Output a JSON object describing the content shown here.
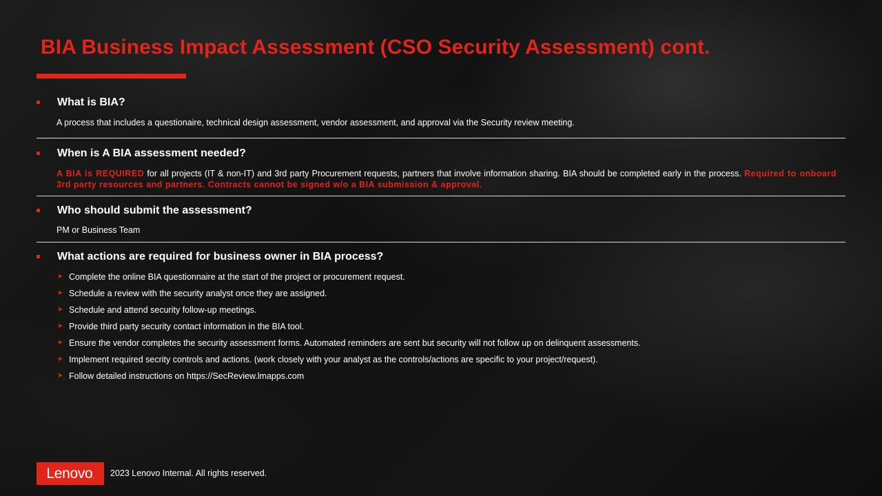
{
  "slide": {
    "title": "BIA Business Impact Assessment (CSO Security Assessment) cont."
  },
  "sections": [
    {
      "heading": "What is BIA?",
      "body": "A process that includes a questionaire, technical design assessment, vendor assessment, and approval via the Security review meeting."
    },
    {
      "heading": "When is A BIA assessment needed?",
      "body_red_1": "A BIA is REQUIRED",
      "body_plain": " for all projects (IT & non-IT) and 3rd party Procurement requests, partners that involve information sharing. BIA should be completed early in the process. ",
      "body_red_2": "Required to onboard 3rd party resources and partners. Contracts cannot be signed w/o a BIA submission & approval."
    },
    {
      "heading": "Who should submit the assessment?",
      "body": "PM or Business Team"
    },
    {
      "heading": "What actions are required for business owner in BIA process?",
      "actions": [
        "Complete the online BIA questionnaire at the start of the project or procurement request.",
        "Schedule a review with the security analyst once they are assigned.",
        "Schedule and attend security follow-up meetings.",
        "Provide third party security contact information in the BIA tool.",
        "Ensure the vendor completes the security assessment forms. Automated reminders are sent but security will not follow up on delinquent assessments.",
        "Implement required secrity controls and actions. (work closely with your analyst as the controls/actions are specific to your project/request).",
        "Follow detailed instructions on https://SecReview.lmapps.com"
      ]
    }
  ],
  "footer": {
    "logo_text": "Lenovo",
    "logo_suffix": ".",
    "copyright": "2023 Lenovo Internal. All rights reserved."
  },
  "colors": {
    "accent": "#e1251b",
    "background": "#151515",
    "text": "#ffffff"
  },
  "icons": {
    "section_bullet": "red-square-bullet-icon",
    "action_bullet": "red-arrow-bullet-icon"
  }
}
